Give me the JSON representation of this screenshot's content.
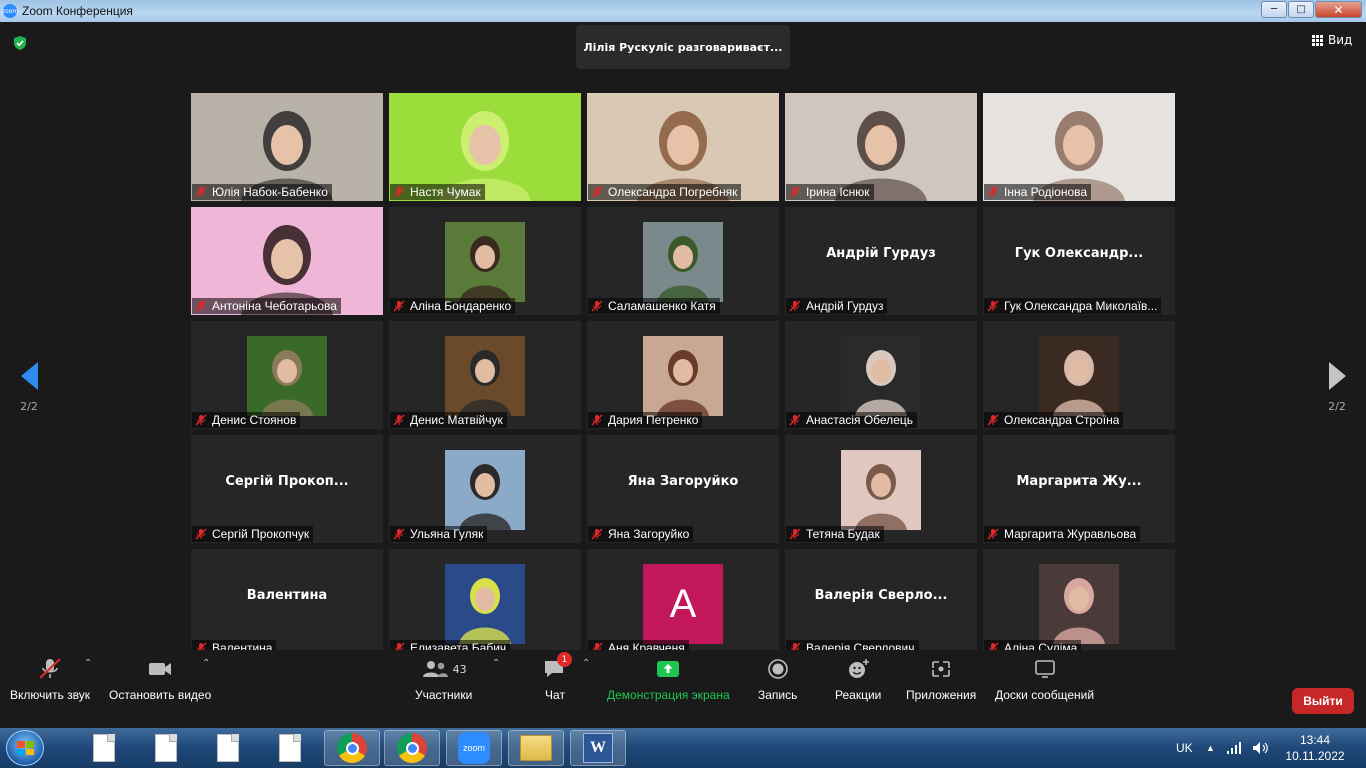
{
  "window": {
    "title": "Zoom Конференция",
    "logo_text": "zoom"
  },
  "meeting": {
    "speaking_banner": "Лілія Рускуліс разговариваєт...",
    "view_label": "Вид",
    "page_left": "2/2",
    "page_right": "2/2"
  },
  "participants": [
    {
      "name": "Юлія Набок-Бабенко",
      "display": "",
      "kind": "video",
      "bg": "#b9b2a8",
      "accent": "#2a2a2a"
    },
    {
      "name": "Настя Чумак",
      "display": "",
      "kind": "video",
      "bg": "#9bdd3a",
      "accent": "#d6f27a"
    },
    {
      "name": "Олександра Погребняк",
      "display": "",
      "kind": "video",
      "bg": "#d8c8b4",
      "accent": "#8a5a3c"
    },
    {
      "name": "Ірина Існюк",
      "display": "",
      "kind": "video",
      "bg": "#cfc6c0",
      "accent": "#4a3a34"
    },
    {
      "name": "Інна Родіонова",
      "display": "",
      "kind": "video",
      "bg": "#e6e2de",
      "accent": "#8a6a5a"
    },
    {
      "name": "Антоніна Чеботарьова",
      "display": "",
      "kind": "video",
      "bg": "#f0b6d8",
      "accent": "#2a1a1a"
    },
    {
      "name": "Аліна Бондаренко",
      "display": "",
      "kind": "photo",
      "bg": "#5a7a3a",
      "accent": "#3a2a20"
    },
    {
      "name": "Саламашенко Катя",
      "display": "",
      "kind": "photo",
      "bg": "#7a8a8c",
      "accent": "#3a5a2a"
    },
    {
      "name": "Андрій Гурдуз",
      "display": "Андрій Гурдуз",
      "kind": "text",
      "bg": "#262626",
      "accent": "#262626"
    },
    {
      "name": "Гук Олександра Миколаїв...",
      "display": "Гук  Олександр...",
      "kind": "text",
      "bg": "#262626",
      "accent": "#262626"
    },
    {
      "name": "Денис Стоянов",
      "display": "",
      "kind": "photo",
      "bg": "#3a6a2a",
      "accent": "#8a7a5a"
    },
    {
      "name": "Денис Матвійчук",
      "display": "",
      "kind": "photo",
      "bg": "#6a4a2a",
      "accent": "#2a2a2a"
    },
    {
      "name": "Дария Петренко",
      "display": "",
      "kind": "photo",
      "bg": "#c8a890",
      "accent": "#6a3a2a"
    },
    {
      "name": "Анастасія Обелець",
      "display": "",
      "kind": "photo",
      "bg": "#2a2a2a",
      "accent": "#d8c8c0"
    },
    {
      "name": "Олександра Строїна",
      "display": "",
      "kind": "photo",
      "bg": "#3a2a22",
      "accent": "#d8b8a8"
    },
    {
      "name": "Сергій Прокопчук",
      "display": "Сергій  Прокоп...",
      "kind": "text",
      "bg": "#262626",
      "accent": "#262626"
    },
    {
      "name": "Ульяна Гуляк",
      "display": "",
      "kind": "photo",
      "bg": "#8aaac8",
      "accent": "#2a2a2a"
    },
    {
      "name": "Яна Загоруйко",
      "display": "Яна Загоруйко",
      "kind": "text",
      "bg": "#262626",
      "accent": "#262626"
    },
    {
      "name": "Тетяна Будак",
      "display": "",
      "kind": "photo",
      "bg": "#e0c8c0",
      "accent": "#7a5a4a"
    },
    {
      "name": "Маргарита Журавльова",
      "display": "Маргарита  Жу...",
      "kind": "text",
      "bg": "#262626",
      "accent": "#262626"
    },
    {
      "name": "Валентина",
      "display": "Валентина",
      "kind": "text",
      "bg": "#262626",
      "accent": "#262626"
    },
    {
      "name": "Елизавета Бабич",
      "display": "",
      "kind": "photo",
      "bg": "#2a4a8a",
      "accent": "#d8e04a"
    },
    {
      "name": "Аня Кравченя",
      "display": "A",
      "kind": "letter",
      "bg": "#262626",
      "accent": "#c2185b"
    },
    {
      "name": "Валерія Сверлович",
      "display": "Валерія  Сверло...",
      "kind": "text",
      "bg": "#262626",
      "accent": "#262626"
    },
    {
      "name": "Аліна Суліма",
      "display": "",
      "kind": "photo",
      "bg": "#4a3a3a",
      "accent": "#d8a8a0"
    }
  ],
  "toolbar": {
    "mic_label": "Включить звук",
    "video_label": "Остановить видео",
    "participants_label": "Участники",
    "participants_count": "43",
    "chat_label": "Чат",
    "chat_badge": "1",
    "share_label": "Демонстрация экрана",
    "record_label": "Запись",
    "reactions_label": "Реакции",
    "apps_label": "Приложения",
    "whiteboards_label": "Доски сообщений",
    "leave_label": "Выйти"
  },
  "taskbar": {
    "zoom_label": "zoom",
    "language": "UK",
    "time": "13:44",
    "date": "10.11.2022"
  }
}
